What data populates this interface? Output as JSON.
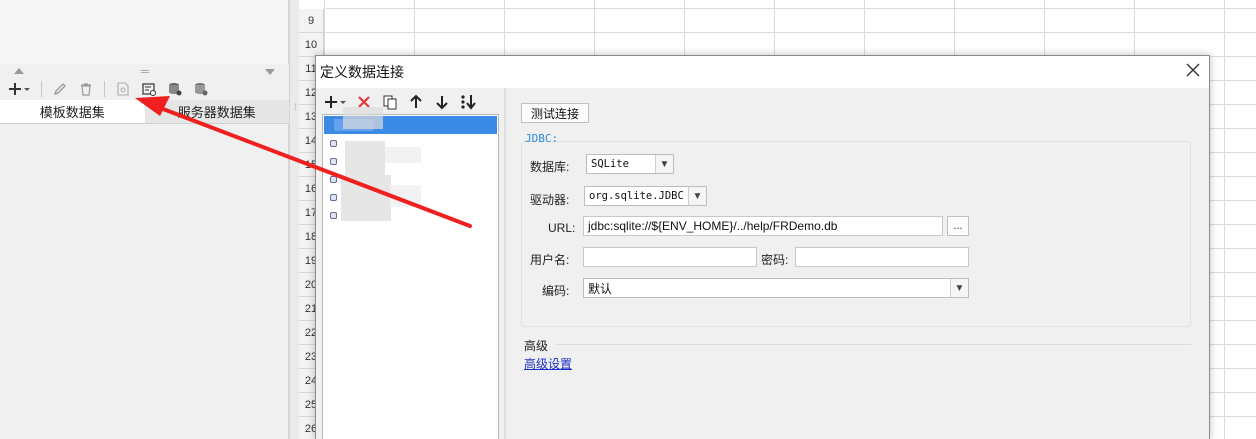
{
  "left_panel": {
    "toolbar_icons": [
      "add-icon",
      "edit-icon",
      "delete-icon",
      "preview-icon",
      "dataset-icon",
      "database-icon",
      "database-settings-icon"
    ],
    "tabs": [
      {
        "label": "模板数据集",
        "active": true
      },
      {
        "label": "服务器数据集",
        "active": false
      }
    ]
  },
  "sheet": {
    "row_numbers": [
      "9",
      "10",
      "11",
      "12",
      "13",
      "14",
      "15",
      "16",
      "17",
      "18",
      "19",
      "20",
      "21",
      "22",
      "23",
      "24",
      "25",
      "26"
    ]
  },
  "dialog": {
    "title": "定义数据连接",
    "close_label": "✕",
    "toolbar": [
      "add-icon",
      "delete-icon",
      "copy-icon",
      "move-up-icon",
      "move-down-icon",
      "sort-icon"
    ],
    "test_button": "测试连接",
    "jdbc_section": "JDBC:",
    "database_label": "数据库:",
    "database_value": "SQLite",
    "driver_label": "驱动器:",
    "driver_value": "org.sqlite.JDBC",
    "url_label": "URL:",
    "url_value": "jdbc:sqlite://${ENV_HOME}/../help/FRDemo.db",
    "url_button": "...",
    "username_label": "用户名:",
    "username_value": "",
    "password_label": "密码:",
    "password_value": "",
    "encoding_label": "编码:",
    "encoding_value": "默认",
    "advanced_label": "高级",
    "advanced_link": "高级设置"
  },
  "colors": {
    "selection": "#3b8ae6",
    "delete_red": "#e53935",
    "jdbc_blue": "#2a8fd3",
    "link_blue": "#1a2fc7",
    "annotation_red": "#f02020"
  }
}
